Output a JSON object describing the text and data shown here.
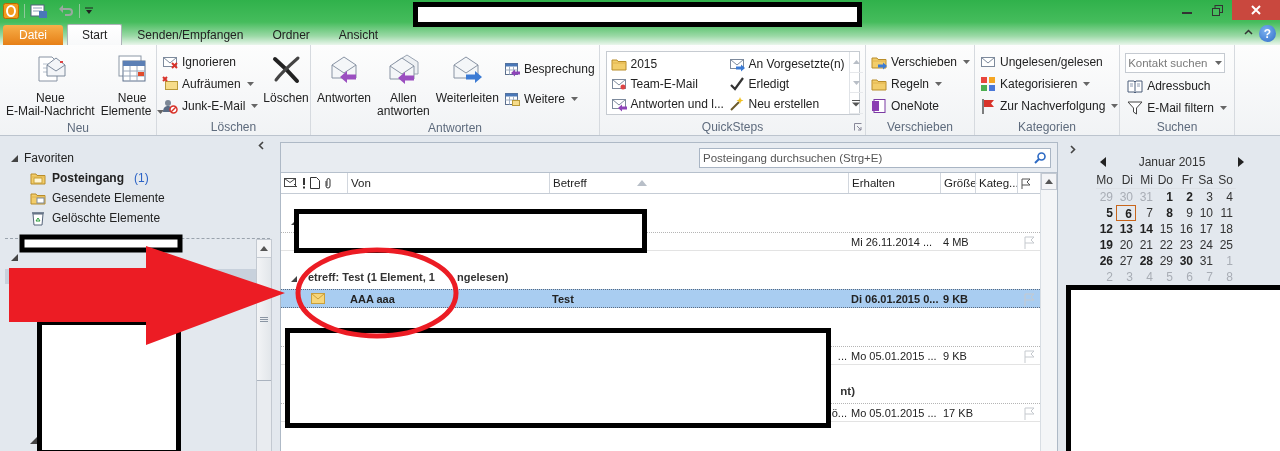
{
  "window": {
    "help_label": "?"
  },
  "ribbon": {
    "tabs": [
      {
        "label": "Datei",
        "kind": "file",
        "selected": false
      },
      {
        "label": "Start",
        "kind": "tab",
        "selected": true
      },
      {
        "label": "Senden/Empfangen",
        "kind": "tab",
        "selected": false
      },
      {
        "label": "Ordner",
        "kind": "tab",
        "selected": false
      },
      {
        "label": "Ansicht",
        "kind": "tab",
        "selected": false
      }
    ],
    "groups": [
      {
        "label": "Neu",
        "items": [
          {
            "kind": "large",
            "lines": [
              "Neue",
              "E-Mail-Nachricht"
            ]
          },
          {
            "kind": "large",
            "lines": [
              "Neue",
              "Elemente"
            ],
            "dropdown": true
          }
        ]
      },
      {
        "label": "Löschen",
        "items": [
          {
            "kind": "column",
            "items": [
              {
                "label": "Ignorieren"
              },
              {
                "label": "Aufräumen",
                "dropdown": true
              },
              {
                "label": "Junk-E-Mail",
                "dropdown": true
              }
            ]
          },
          {
            "kind": "large",
            "lines": [
              "Löschen"
            ]
          }
        ]
      },
      {
        "label": "Antworten",
        "items": [
          {
            "kind": "large",
            "lines": [
              "Antworten"
            ]
          },
          {
            "kind": "large",
            "lines": [
              "Allen",
              "antworten"
            ]
          },
          {
            "kind": "large",
            "lines": [
              "Weiterleiten"
            ]
          },
          {
            "kind": "column",
            "items": [
              {
                "label": "Besprechung"
              },
              {
                "label": "Weitere",
                "dropdown": true
              }
            ]
          }
        ]
      },
      {
        "label": "QuickSteps",
        "launcher": true,
        "items": [
          {
            "kind": "gallery",
            "items": [
              {
                "label": "2015"
              },
              {
                "label": "An Vorgesetzte(n)"
              },
              {
                "label": "Team-E-Mail"
              },
              {
                "label": "Erledigt"
              },
              {
                "label": "Antworten und l..."
              },
              {
                "label": "Neu erstellen"
              }
            ]
          }
        ]
      },
      {
        "label": "Verschieben",
        "items": [
          {
            "kind": "column",
            "items": [
              {
                "label": "Verschieben",
                "dropdown": true
              },
              {
                "label": "Regeln",
                "dropdown": true
              },
              {
                "label": "OneNote"
              }
            ]
          }
        ]
      },
      {
        "label": "Kategorien",
        "items": [
          {
            "kind": "column",
            "items": [
              {
                "label": "Ungelesen/gelesen"
              },
              {
                "label": "Kategorisieren",
                "dropdown": true
              },
              {
                "label": "Zur Nachverfolgung",
                "dropdown": true
              }
            ]
          }
        ]
      },
      {
        "label": "Suchen",
        "items": [
          {
            "kind": "column",
            "items": [
              {
                "kind": "field",
                "placeholder": "Kontakt suchen",
                "dropdown": true
              },
              {
                "kind": "button",
                "label": "Adressbuch"
              },
              {
                "kind": "button",
                "label": "E-Mail filtern",
                "dropdown": true
              }
            ]
          }
        ]
      }
    ]
  },
  "navigation": {
    "favorites": {
      "label": "Favoriten",
      "expanded": true,
      "items": [
        {
          "label": "Posteingang",
          "count": "(1)",
          "unread": true
        },
        {
          "label": "Gesendete Elemente",
          "unread": false
        },
        {
          "label": "Gelöschte Elemente",
          "unread": false
        }
      ]
    }
  },
  "mail_list": {
    "search": {
      "placeholder": "Posteingang durchsuchen (Strg+E)"
    },
    "columns": [
      {
        "label": "Von"
      },
      {
        "label": "Betreff",
        "sorted": true
      },
      {
        "label": "Erhalten"
      },
      {
        "label": "Größe"
      },
      {
        "label": "Kateg..."
      }
    ],
    "groups": [
      {
        "expanded": true,
        "items": [
          {
            "received": "Mi 26.11.2014 ...",
            "size": "4 MB",
            "unread": false,
            "selected": false
          }
        ]
      },
      {
        "expanded": true,
        "header": "etreff: Test (1 Element, 1",
        "header_tail": "ngelesen)",
        "items": [
          {
            "from": "AAA aaa",
            "subject": "Test",
            "received": "Di 06.01.2015 0...",
            "size": "9 KB",
            "unread": true,
            "selected": true
          }
        ]
      },
      {
        "expanded": true,
        "items": [
          {
            "subject": "...",
            "subject_clipped": true,
            "received": "Mo 05.01.2015 ...",
            "size": "9 KB",
            "unread": false,
            "selected": false
          }
        ]
      },
      {
        "expanded": true,
        "header": "nt)",
        "header_clipped": true,
        "items": [
          {
            "subject": "ö...",
            "subject_clipped": true,
            "received": "Mo 05.01.2015 ...",
            "size": "17 KB",
            "unread": false,
            "selected": false
          }
        ]
      }
    ]
  },
  "calendar": {
    "month": "Januar 2015",
    "weekdays": [
      "Mo",
      "Di",
      "Mi",
      "Do",
      "Fr",
      "Sa",
      "So"
    ],
    "weeks": [
      [
        {
          "day": "29",
          "other_month": true,
          "has_items": false,
          "today": false
        },
        {
          "day": "30",
          "other_month": true,
          "has_items": false,
          "today": false
        },
        {
          "day": "31",
          "other_month": true,
          "has_items": false,
          "today": false
        },
        {
          "day": "1",
          "other_month": false,
          "has_items": true,
          "today": false
        },
        {
          "day": "2",
          "other_month": false,
          "has_items": true,
          "today": false
        },
        {
          "day": "3",
          "other_month": false,
          "has_items": false,
          "today": false
        },
        {
          "day": "4",
          "other_month": false,
          "has_items": false,
          "today": false
        }
      ],
      [
        {
          "day": "5",
          "other_month": false,
          "has_items": true,
          "today": false
        },
        {
          "day": "6",
          "other_month": false,
          "has_items": true,
          "today": true
        },
        {
          "day": "7",
          "other_month": false,
          "has_items": false,
          "today": false
        },
        {
          "day": "8",
          "other_month": false,
          "has_items": true,
          "today": false
        },
        {
          "day": "9",
          "other_month": false,
          "has_items": false,
          "today": false
        },
        {
          "day": "10",
          "other_month": false,
          "has_items": false,
          "today": false
        },
        {
          "day": "11",
          "other_month": false,
          "has_items": false,
          "today": false
        }
      ],
      [
        {
          "day": "12",
          "other_month": false,
          "has_items": true,
          "today": false
        },
        {
          "day": "13",
          "other_month": false,
          "has_items": true,
          "today": false
        },
        {
          "day": "14",
          "other_month": false,
          "has_items": true,
          "today": false
        },
        {
          "day": "15",
          "other_month": false,
          "has_items": false,
          "today": false
        },
        {
          "day": "16",
          "other_month": false,
          "has_items": false,
          "today": false
        },
        {
          "day": "17",
          "other_month": false,
          "has_items": false,
          "today": false
        },
        {
          "day": "18",
          "other_month": false,
          "has_items": false,
          "today": false
        }
      ],
      [
        {
          "day": "19",
          "other_month": false,
          "has_items": true,
          "today": false
        },
        {
          "day": "20",
          "other_month": false,
          "has_items": false,
          "today": false
        },
        {
          "day": "21",
          "other_month": false,
          "has_items": false,
          "today": false
        },
        {
          "day": "22",
          "other_month": false,
          "has_items": false,
          "today": false
        },
        {
          "day": "23",
          "other_month": false,
          "has_items": false,
          "today": false
        },
        {
          "day": "24",
          "other_month": false,
          "has_items": false,
          "today": false
        },
        {
          "day": "25",
          "other_month": false,
          "has_items": false,
          "today": false
        }
      ],
      [
        {
          "day": "26",
          "other_month": false,
          "has_items": true,
          "today": false
        },
        {
          "day": "27",
          "other_month": false,
          "has_items": false,
          "today": false
        },
        {
          "day": "28",
          "other_month": false,
          "has_items": true,
          "today": false
        },
        {
          "day": "29",
          "other_month": false,
          "has_items": false,
          "today": false
        },
        {
          "day": "30",
          "other_month": false,
          "has_items": true,
          "today": false
        },
        {
          "day": "31",
          "other_month": false,
          "has_items": false,
          "today": false
        },
        {
          "day": "1",
          "other_month": true,
          "has_items": false,
          "today": false
        }
      ],
      [
        {
          "day": "2",
          "other_month": true,
          "has_items": false,
          "today": false
        },
        {
          "day": "3",
          "other_month": true,
          "has_items": false,
          "today": false
        },
        {
          "day": "4",
          "other_month": true,
          "has_items": false,
          "today": false
        },
        {
          "day": "5",
          "other_month": true,
          "has_items": false,
          "today": false
        },
        {
          "day": "6",
          "other_month": true,
          "has_items": false,
          "today": false
        },
        {
          "day": "7",
          "other_month": true,
          "has_items": false,
          "today": false
        },
        {
          "day": "8",
          "other_month": true,
          "has_items": false,
          "today": false
        }
      ]
    ]
  }
}
